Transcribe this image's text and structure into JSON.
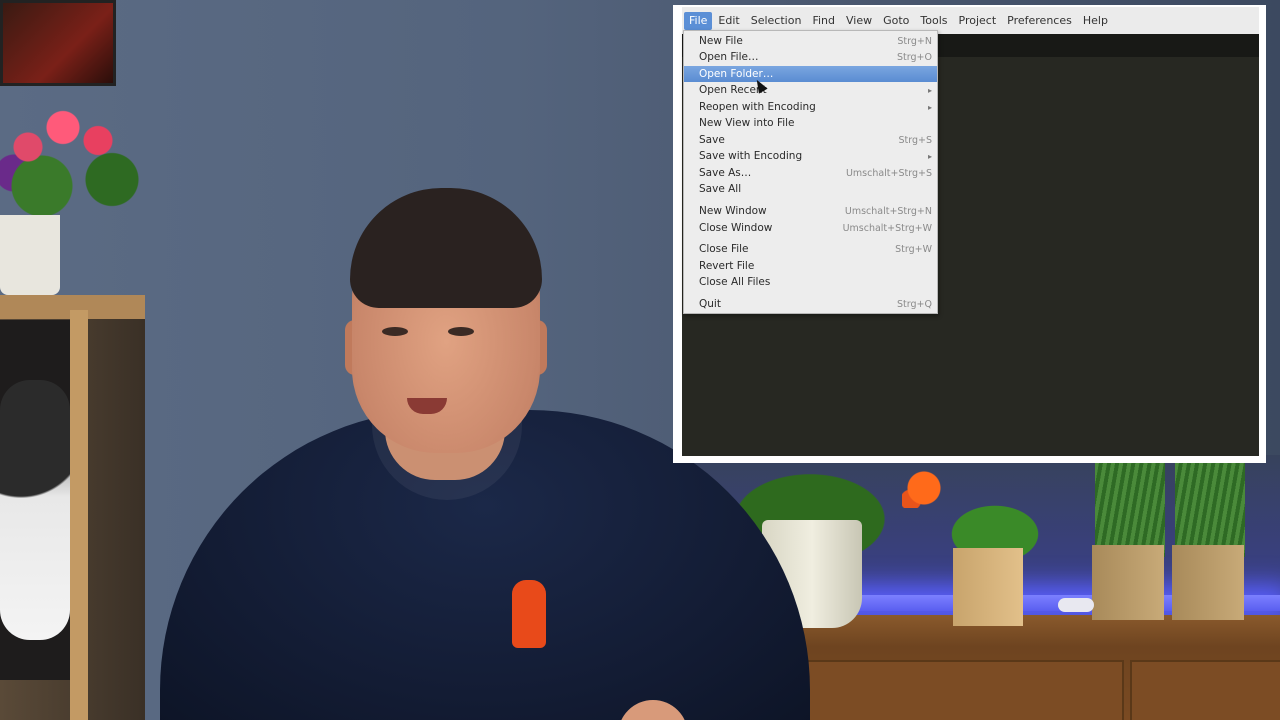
{
  "menubar": {
    "items": [
      "File",
      "Edit",
      "Selection",
      "Find",
      "View",
      "Goto",
      "Tools",
      "Project",
      "Preferences",
      "Help"
    ],
    "active_index": 0
  },
  "file_menu": {
    "items": [
      {
        "label": "New File",
        "shortcut": "Strg+N"
      },
      {
        "label": "Open File…",
        "shortcut": "Strg+O"
      },
      {
        "label": "Open Folder…",
        "shortcut": "",
        "highlighted": true
      },
      {
        "label": "Open Recent",
        "shortcut": "",
        "submenu": true
      },
      {
        "label": "Reopen with Encoding",
        "shortcut": "",
        "submenu": true
      },
      {
        "label": "New View into File",
        "shortcut": ""
      },
      {
        "label": "Save",
        "shortcut": "Strg+S"
      },
      {
        "label": "Save with Encoding",
        "shortcut": "",
        "submenu": true
      },
      {
        "label": "Save As…",
        "shortcut": "Umschalt+Strg+S"
      },
      {
        "label": "Save All",
        "shortcut": ""
      },
      {
        "label": "New Window",
        "shortcut": "Umschalt+Strg+N"
      },
      {
        "label": "Close Window",
        "shortcut": "Umschalt+Strg+W"
      },
      {
        "label": "Close File",
        "shortcut": "Strg+W"
      },
      {
        "label": "Revert File",
        "shortcut": ""
      },
      {
        "label": "Close All Files",
        "shortcut": ""
      },
      {
        "label": "Quit",
        "shortcut": "Strg+Q"
      }
    ]
  },
  "icons": {
    "submenu_arrow": "chevron-right-icon",
    "cursor": "mouse-pointer-icon"
  },
  "colors": {
    "menu_highlight": "#5b8fd6",
    "editor_bg": "#272822",
    "menubar_bg": "#ebebeb"
  }
}
